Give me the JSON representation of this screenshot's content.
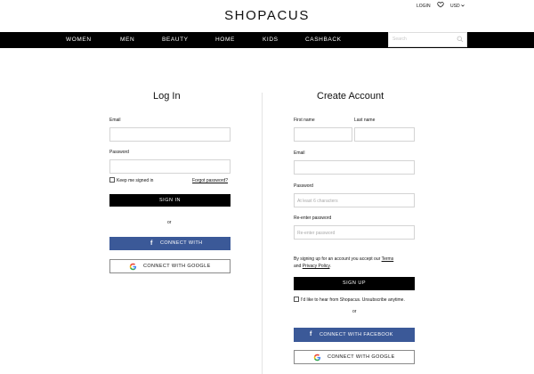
{
  "header": {
    "logo": "SHOPACUS",
    "login_link": "LOGIN",
    "favorites_icon": "heart-icon",
    "currency": "USD",
    "currency_icon": "chevron-down-icon"
  },
  "nav": {
    "items": [
      "WOMEN",
      "MEN",
      "BEAUTY",
      "HOME",
      "KIDS",
      "CASHBACK"
    ],
    "search_placeholder": "Search",
    "search_icon": "search-icon"
  },
  "login": {
    "title": "Log In",
    "email_label": "Email",
    "password_label": "Password",
    "keep_signed_in": "Keep me signed in",
    "forgot_password": "Forgot password?",
    "sign_in": "SIGN IN",
    "or": "or",
    "facebook": "CONNECT WITH FACEBOOK",
    "google": "CONNECT WITH GOOGLE"
  },
  "signup": {
    "title": "Create Account",
    "first_name_label": "First name",
    "last_name_label": "Last name",
    "email_label": "Email",
    "password_label": "Password",
    "password_placeholder": "At least 6 characters",
    "reenter_label": "Re-enter password",
    "reenter_placeholder": "Re-enter password",
    "terms_prefix": "By signing up for an account you accept our ",
    "terms_link": "Terms",
    "terms_and": "and ",
    "privacy_link": "Privacy Policy",
    "terms_suffix": ".",
    "sign_up": "SIGN UP",
    "newsletter": "I'd like to hear from Shopacus. Unsubscribe anytime.",
    "or": "or",
    "facebook": "CONNECT WITH FACEBOOK",
    "google": "CONNECT WITH GOOGLE"
  },
  "colors": {
    "nav_bg": "#000000",
    "facebook_blue": "#3b5998",
    "primary_button": "#000000"
  }
}
